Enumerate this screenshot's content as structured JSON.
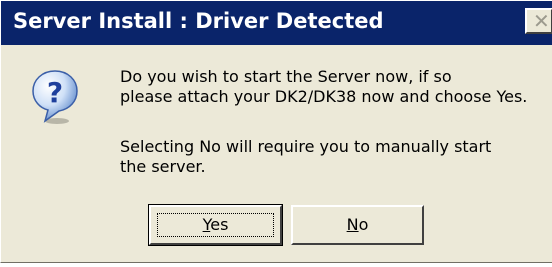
{
  "dialog": {
    "title": "Server Install : Driver Detected",
    "close_label": "✕",
    "icon": "question-icon",
    "message_lines": [
      "Do you wish to start the Server now, if so",
      "please attach your DK2/DK38 now and choose Yes.",
      "Selecting No will require you to manually start",
      "the server."
    ],
    "buttons": {
      "yes": {
        "mnemonic": "Y",
        "rest": "es"
      },
      "no": {
        "mnemonic": "N",
        "rest": "o"
      }
    },
    "colors": {
      "titlebar": "#0a246a",
      "face": "#ece9d8"
    }
  }
}
